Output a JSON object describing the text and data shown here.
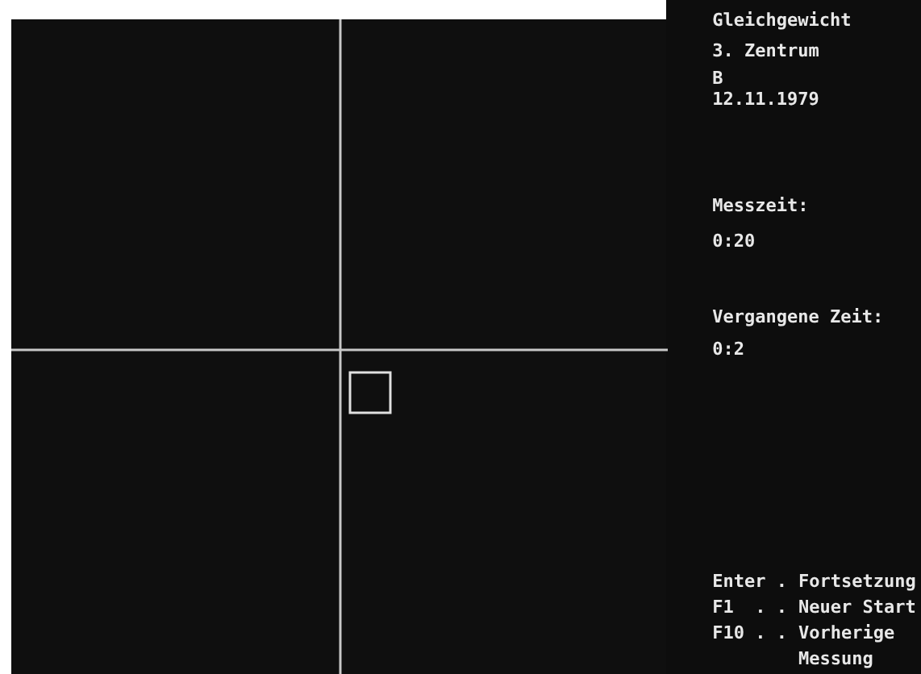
{
  "info": {
    "title": "Gleichgewicht",
    "center": "3. Zentrum",
    "subject": "B",
    "date": "12.11.1979"
  },
  "measure_time": {
    "label": "Messzeit:",
    "value": "0:20"
  },
  "elapsed_time": {
    "label": "Vergangene Zeit:",
    "value": "0:2"
  },
  "keys": [
    {
      "key": "Enter .",
      "action": "Fortsetzung"
    },
    {
      "key": "F1  . .",
      "action": "Neuer Start"
    },
    {
      "key": "F10 . .",
      "action": "Vorherige Messung"
    }
  ]
}
